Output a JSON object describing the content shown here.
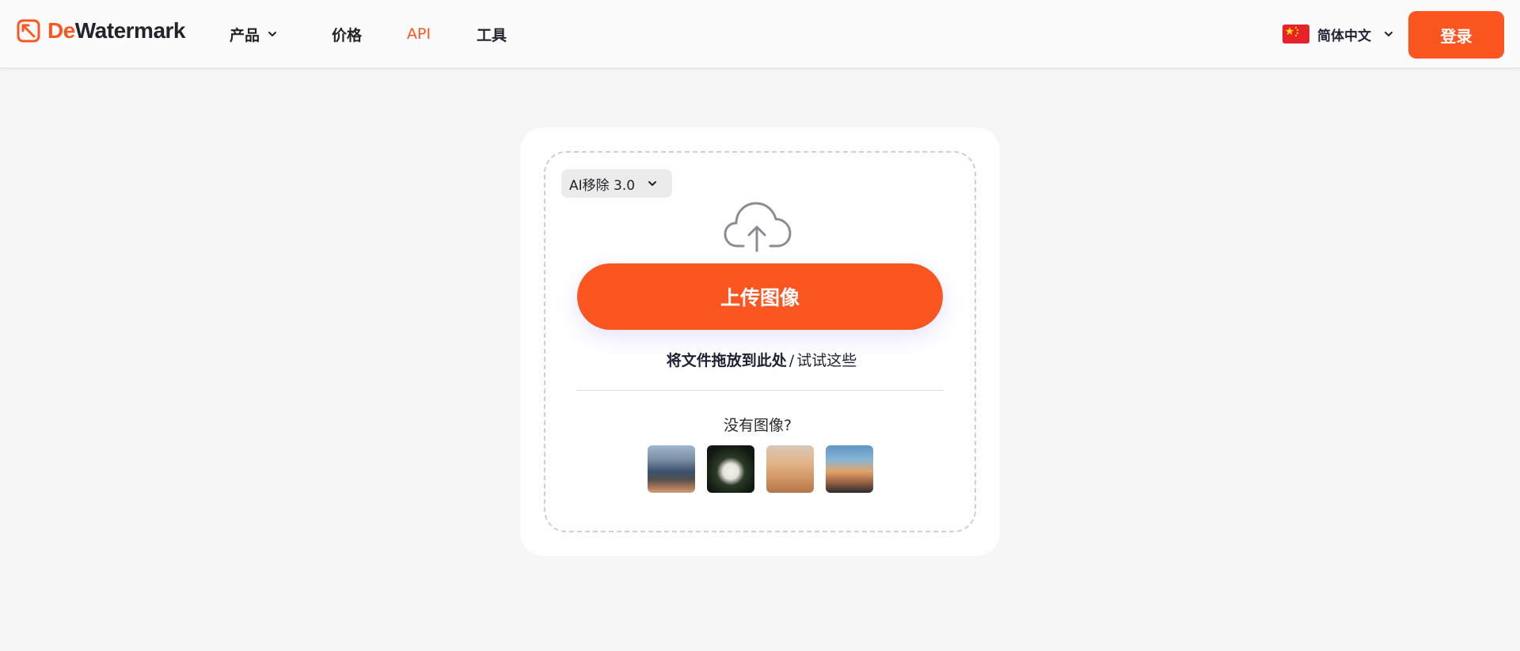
{
  "header": {
    "logo": {
      "accent": "De",
      "rest": "Watermark"
    },
    "nav": {
      "products": "产品",
      "pricing": "价格",
      "api": "API",
      "tools": "工具"
    },
    "language": "简体中文",
    "login": "登录"
  },
  "main": {
    "model_select": "AI移除 3.0",
    "upload_button": "上传图像",
    "drop_hint_bold": "将文件拖放到此处",
    "drop_hint_sep": "/",
    "drop_hint_try": "试试这些",
    "no_image": "没有图像?",
    "samples": [
      "lake-sample-icon",
      "woman-flowers-sample-icon",
      "desert-sample-icon",
      "sunset-sample-icon"
    ]
  },
  "colors": {
    "accent": "#fb5520",
    "background": "#f6f6f6",
    "card": "#ffffff"
  }
}
